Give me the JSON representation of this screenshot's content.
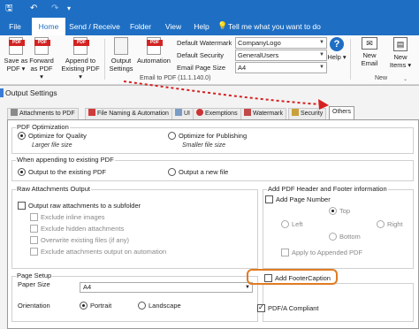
{
  "ribbon": {
    "tabs": [
      "File",
      "Home",
      "Send / Receive",
      "Folder",
      "View",
      "Help"
    ],
    "active_tab": "Home",
    "tell_me": "Tell me what you want to do",
    "buttons": {
      "save_as_pdf": "Save as PDF ▾",
      "forward_as_pdf": "Forward as PDF ▾",
      "append_existing": "Append to Existing PDF ▾",
      "output_settings": "Output Settings",
      "automation": "Automation",
      "help": "Help ▾",
      "new_email": "New Email",
      "new_items": "New Items ▾"
    },
    "fields": [
      {
        "label": "Default Watermark",
        "value": "CompanyLogo"
      },
      {
        "label": "Default Security",
        "value": "GeneralUsers"
      },
      {
        "label": "Email Page Size",
        "value": "A4"
      }
    ],
    "group_caption": "Email to PDF (11.1.140.0)",
    "new_group_caption": "New",
    "pdf_icon_text": "PDF"
  },
  "dialog": {
    "title": "Output Settings",
    "tabs": [
      "Attachments to PDF",
      "File Naming & Automation",
      "UI",
      "Exemptions",
      "Watermark",
      "Security",
      "Others"
    ],
    "selected_tab": "Others",
    "pdf_optimization": {
      "title": "PDF Optimization",
      "quality": "Optimize for Quality",
      "quality_sub": "Larger file size",
      "publishing": "Optimize for Publishing",
      "publishing_sub": "Smaller file size"
    },
    "append": {
      "title": "When appending to existing PDF",
      "existing": "Output to the existing PDF",
      "new": "Output a new file"
    },
    "raw": {
      "title": "Raw Attachments Output",
      "subfolder": "Output raw attachments to a subfolder",
      "inline": "Exclude inline images",
      "hidden": "Exclude hidden attachments",
      "overwrite": "Overwrite existing files (if any)",
      "automation": "Exclude attachments output on automation"
    },
    "header_footer": {
      "title": "Add PDF Header and Footer information",
      "page_number": "Add Page Number",
      "top": "Top",
      "left": "Left",
      "right": "Right",
      "bottom": "Bottom",
      "apply": "Apply to Appended PDF",
      "caption": "Add FooterCaption"
    },
    "page_setup": {
      "title": "Page Setup",
      "paper_label": "Paper Size",
      "paper_value": "A4",
      "orientation_label": "Orientation",
      "portrait": "Portrait",
      "landscape": "Landscape"
    },
    "pdfa": "PDF/A Compliant"
  },
  "colors": {
    "accent": "#1e6fc4",
    "highlight": "#e07b21",
    "arrow": "#d62020"
  }
}
